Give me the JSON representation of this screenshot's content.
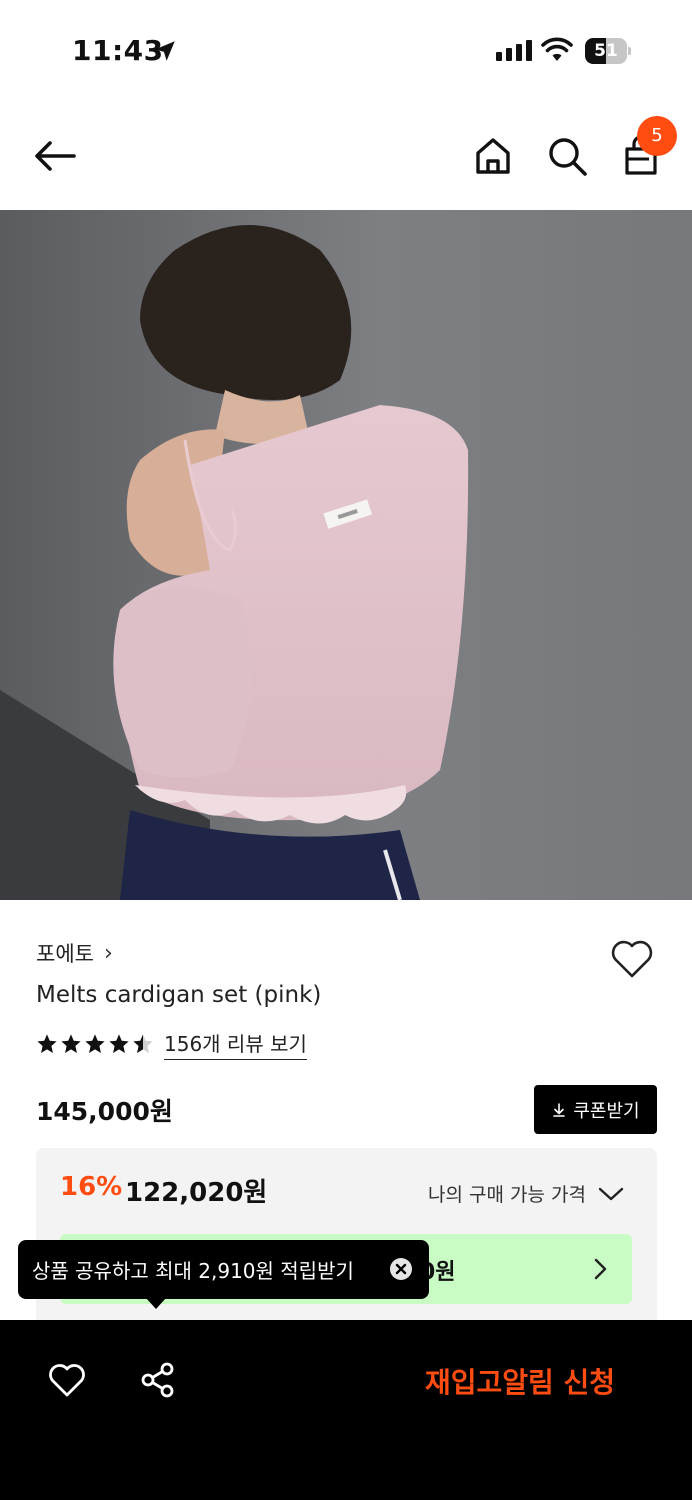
{
  "status_bar": {
    "time": "11:43",
    "battery_level": "51",
    "battery_fraction": 0.51
  },
  "nav": {
    "back_icon": "arrow-left-icon",
    "home_icon": "home-icon",
    "search_icon": "search-icon",
    "cart_icon": "shopping-bag-icon",
    "cart_count": "5"
  },
  "product": {
    "brand": "포에토",
    "brand_chevron": "›",
    "name": "Melts cardigan set (pink)",
    "rating": 4.5,
    "review_link": "156개 리뷰 보기",
    "price": "145,000원",
    "coupon_label": "쿠폰받기",
    "coupon_icon": "download-icon",
    "wishlist_icon": "heart-outline-icon"
  },
  "price_box": {
    "discount_percent": "16%",
    "discount_price": "122,020원",
    "my_price_label": "나의 구매 가능 가격",
    "green_bar_partial": "0원"
  },
  "tooltip": {
    "text": "상품 공유하고 최대 2,910원 적립받기"
  },
  "bottom_bar": {
    "like_icon": "heart-outline-icon",
    "share_icon": "share-icon",
    "restock_label": "재입고알림 신청"
  },
  "colors": {
    "accent": "#ff4d12",
    "green_bar": "#c8fcc4",
    "price_box_bg": "#f3f3f3",
    "bottom_bar_bg": "#000000"
  }
}
